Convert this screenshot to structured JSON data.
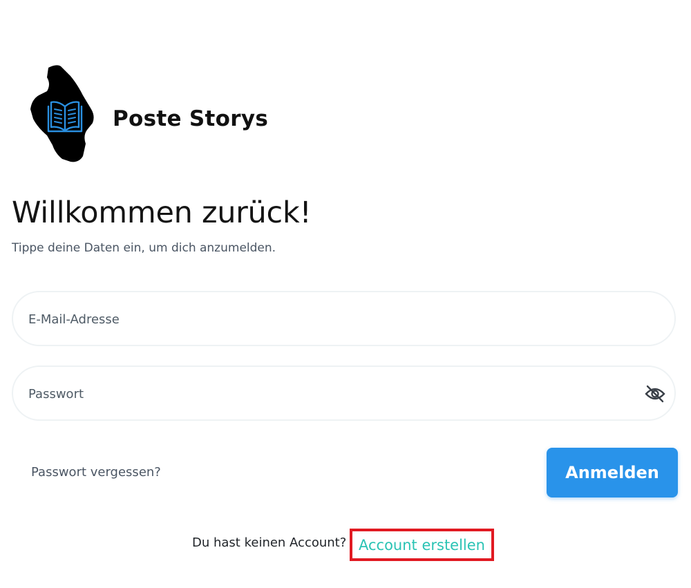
{
  "brand": {
    "name": "Poste Storys",
    "logo_icon": "book-icon",
    "logo_colors": {
      "splash": "#000000",
      "book": "#2a8fe0"
    }
  },
  "header": {
    "title": "Willkommen zurück!",
    "subtitle": "Tippe deine Daten ein, um dich anzumelden."
  },
  "form": {
    "email": {
      "placeholder": "E-Mail-Adresse",
      "value": ""
    },
    "password": {
      "placeholder": "Passwort",
      "value": "",
      "visibility_icon": "eye-slash-icon"
    },
    "forgot_password": "Passwort vergessen?",
    "submit_label": "Anmelden"
  },
  "signup": {
    "prompt": "Du hast keinen Account?",
    "link_label": "Account erstellen"
  },
  "colors": {
    "primary": "#2993ea",
    "link": "#2ac3b4",
    "highlight": "#e11a22"
  }
}
